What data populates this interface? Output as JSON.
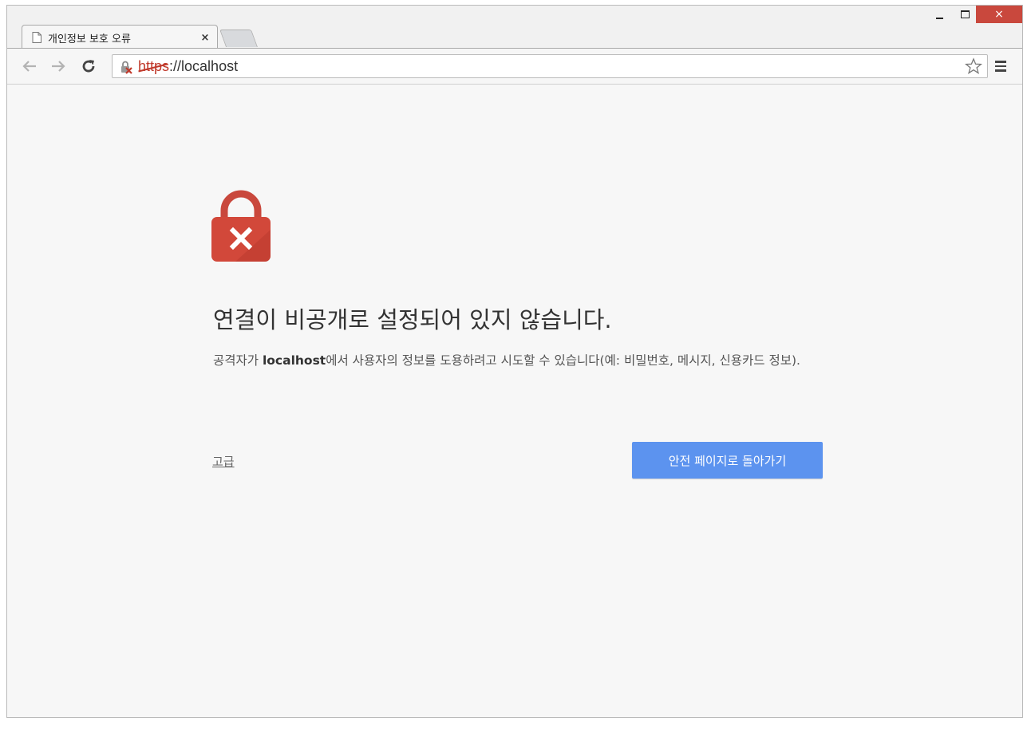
{
  "window": {
    "close_glyph": "×"
  },
  "tab": {
    "title": "개인정보 보호 오류",
    "close_glyph": "×"
  },
  "toolbar": {
    "url_scheme": "https",
    "url_rest": "://localhost"
  },
  "error": {
    "heading": "연결이 비공개로 설정되어 있지 않습니다.",
    "desc_prefix": "공격자가 ",
    "desc_host": "localhost",
    "desc_suffix": "에서 사용자의 정보를 도용하려고 시도할 수 있습니다(예: 비밀번호, 메시지, 신용카드 정보).",
    "advanced_link": "고급",
    "back_button": "안전 페이지로 돌아가기"
  },
  "colors": {
    "lock_red": "#d2483a",
    "button_blue": "#5c93ef",
    "close_red": "#c9483d"
  }
}
